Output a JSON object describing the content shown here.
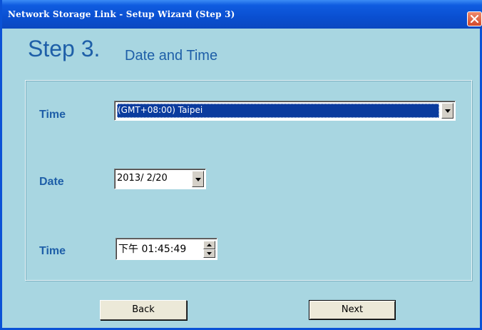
{
  "window": {
    "title": "Network Storage Link - Setup Wizard (Step 3)"
  },
  "header": {
    "step": "Step 3.",
    "title": "Date and Time"
  },
  "form": {
    "timezone_label": "Time",
    "timezone_value": "(GMT+08:00) Taipei",
    "date_label": "Date",
    "date_value": "2013/ 2/20",
    "time_label": "Time",
    "time_value": "下午 01:45:49"
  },
  "buttons": {
    "back": "Back",
    "next": "Next"
  },
  "icons": {
    "close": "close-icon",
    "dropdown": "chevron-down-icon",
    "spin_up": "arrow-up-icon",
    "spin_down": "arrow-down-icon"
  },
  "colors": {
    "background": "#a8d6e1",
    "titlebar": "#0a4fd1",
    "heading": "#1e5fa8",
    "selection": "#0a3b9e"
  }
}
